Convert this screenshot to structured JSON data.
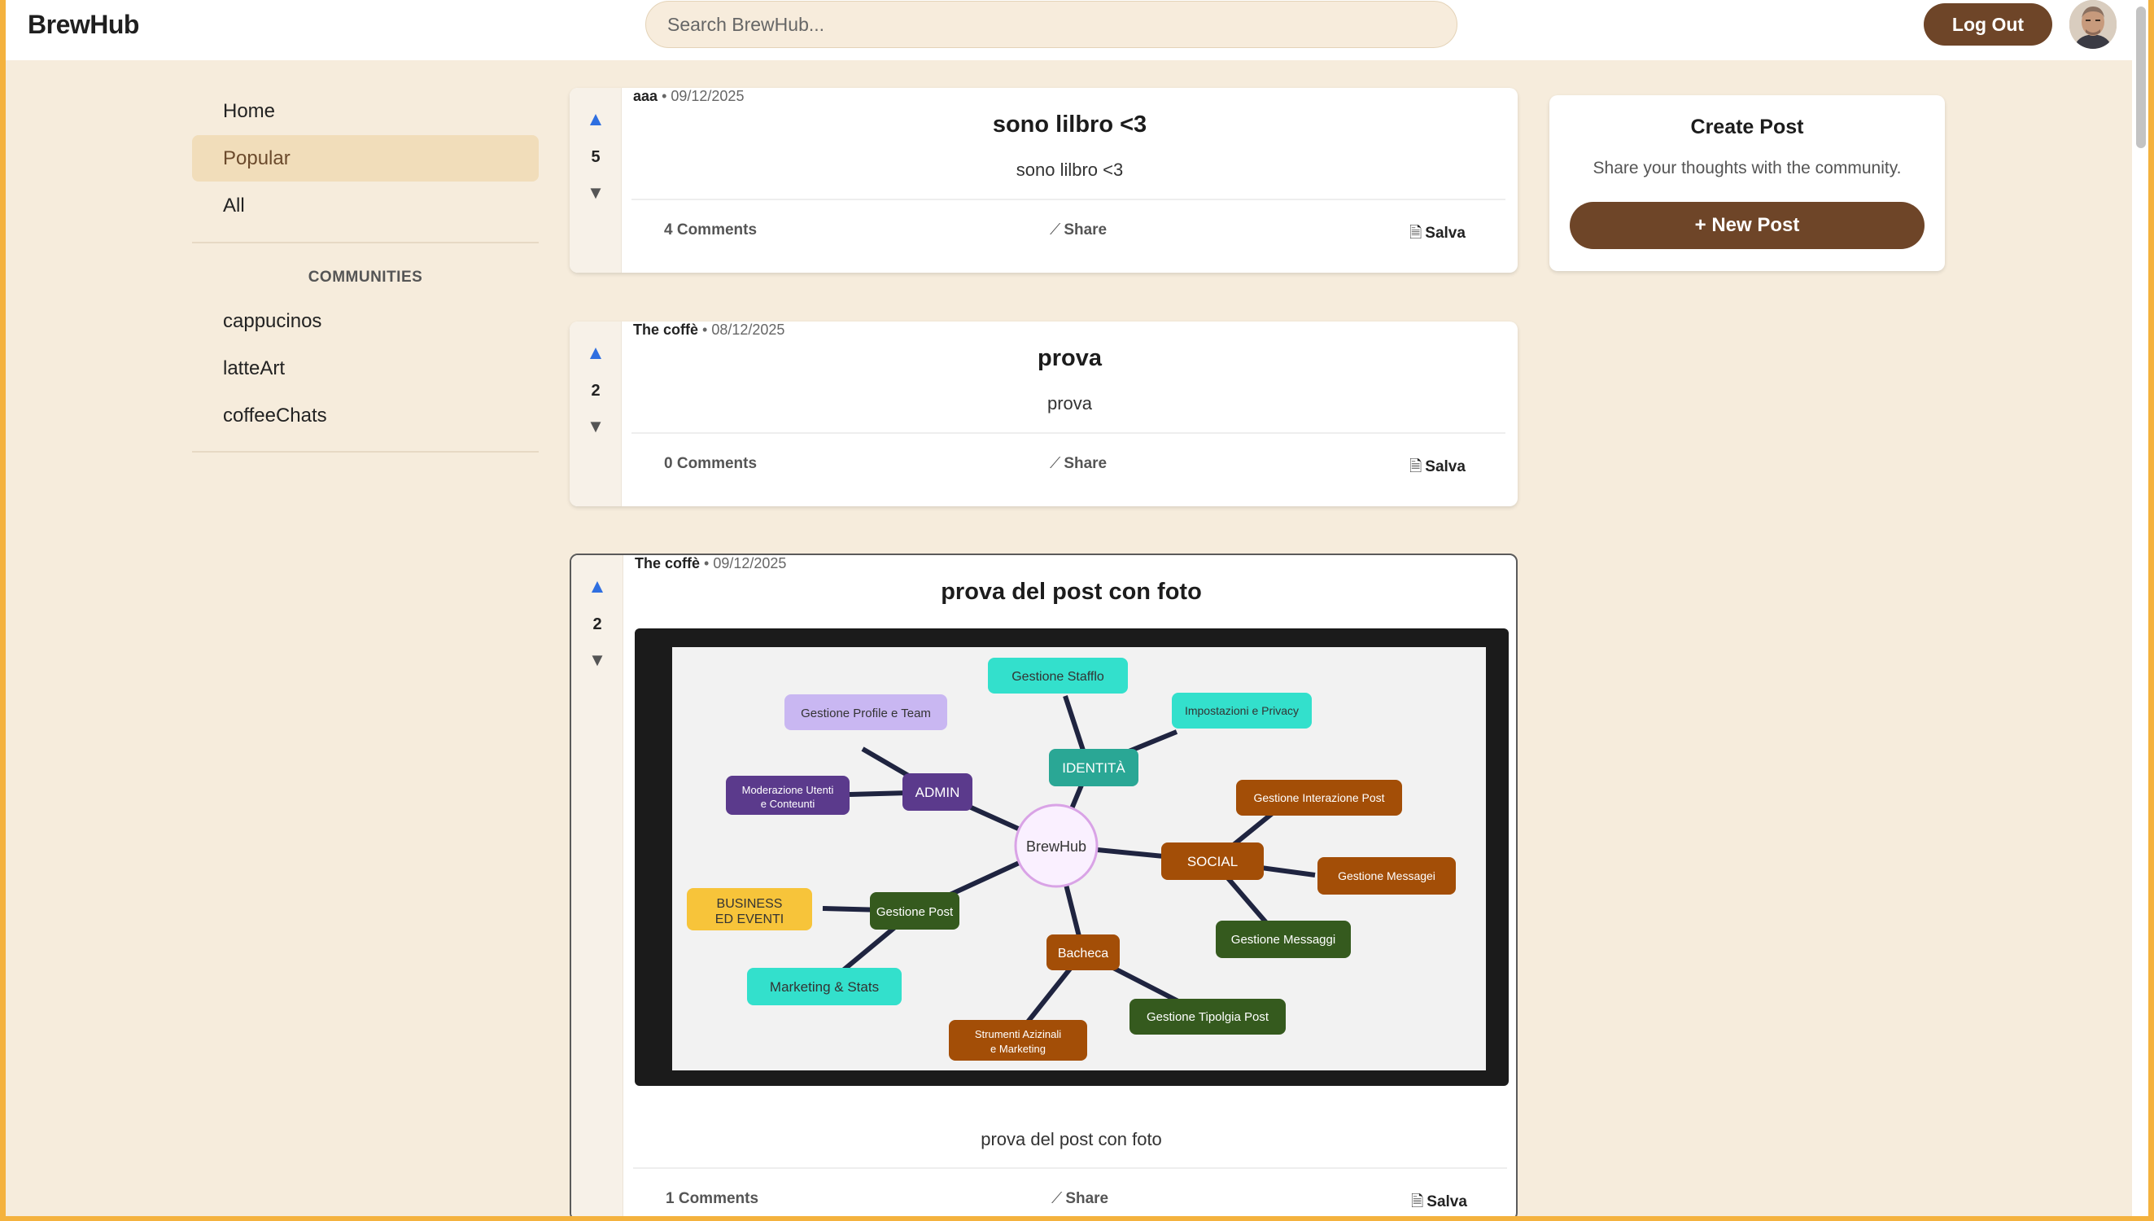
{
  "app": {
    "brand": "BrewHub"
  },
  "header": {
    "search_placeholder": "Search BrewHub...",
    "logout_label": "Log Out",
    "avatar_icon": "user-avatar"
  },
  "sidebar": {
    "items": [
      {
        "label": "Home",
        "active": false
      },
      {
        "label": "Popular",
        "active": true
      },
      {
        "label": "All",
        "active": false
      }
    ],
    "communities_heading": "COMMUNITIES",
    "communities": [
      "cappucinos",
      "latteArt",
      "coffeeChats"
    ]
  },
  "posts": [
    {
      "author": "aaa",
      "date": "• 09/12/2025",
      "votes": "5",
      "title": "sono lilbro <3",
      "body": "sono lilbro <3",
      "comments": "4 Comments",
      "share": "Share",
      "save": "Salva"
    },
    {
      "author": "The coffè",
      "date": "• 08/12/2025",
      "votes": "2",
      "title": "prova",
      "body": "prova",
      "comments": "0 Comments",
      "share": "Share",
      "save": "Salva"
    },
    {
      "author": "The coffè",
      "date": "• 09/12/2025",
      "votes": "2",
      "title": "prova del post con foto",
      "body": "prova del post con foto",
      "comments": "1 Comments",
      "share": "Share",
      "save": "Salva",
      "image_nodes": {
        "center": "BrewHub",
        "admin": "ADMIN",
        "identita": "IDENTITÀ",
        "social": "SOCIAL",
        "bacheca": "Bacheca",
        "gestione_post": "Gestione Post",
        "gestione_profile": "Gestione Profile e Team",
        "moderazione_1": "Moderazione Utenti",
        "moderazione_2": "e Conteunti",
        "gestione_staff": "Gestione Stafflo",
        "impostazioni": "Impostazioni e Privacy",
        "interazione": "Gestione Interazione Post",
        "messagei": "Gestione Messagei",
        "messaggi": "Gestione Messaggi",
        "tipolgia": "Gestione Tipolgia Post",
        "strumenti_1": "Strumenti Azizinali",
        "strumenti_2": "e Marketing",
        "marketing": "Marketing & Stats",
        "business_1": "BUSINESS",
        "business_2": "ED EVENTI"
      }
    }
  ],
  "create_post": {
    "title": "Create Post",
    "subtitle": "Share your thoughts with the community.",
    "button": "+ New Post"
  },
  "colors": {
    "page_bg": "#f6ecdc",
    "accent_brown": "#6e4528",
    "active_nav": "#f1ddba",
    "frame": "#f4b23e",
    "upvote": "#2f6fe0"
  }
}
